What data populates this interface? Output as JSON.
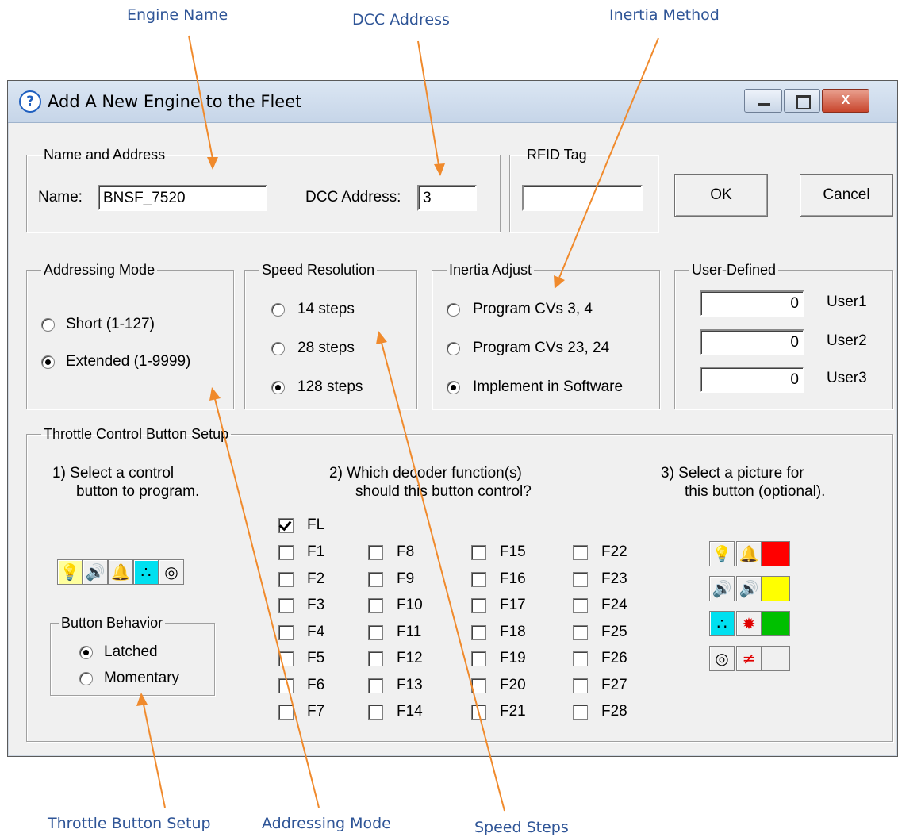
{
  "annotations": {
    "engine_name": "Engine Name",
    "dcc_address": "DCC Address",
    "inertia_method": "Inertia Method",
    "throttle_button_setup": "Throttle Button Setup",
    "addressing_mode": "Addressing Mode",
    "speed_steps": "Speed Steps",
    "arrow_color": "#f08a2c",
    "text_color": "#2f5597"
  },
  "window": {
    "title": "Add A New Engine to the Fleet",
    "title_icon": "?",
    "close_glyph": "X"
  },
  "name_address": {
    "legend": "Name and Address",
    "name_label": "Name:",
    "name_value": "BNSF_7520",
    "dcc_label": "DCC Address:",
    "dcc_value": "3"
  },
  "rfid": {
    "legend": "RFID Tag",
    "value": ""
  },
  "buttons": {
    "ok": "OK",
    "cancel": "Cancel"
  },
  "addressing_mode": {
    "legend": "Addressing Mode",
    "options": [
      "Short  (1-127)",
      "Extended  (1-9999)"
    ],
    "selected": "Extended  (1-9999)"
  },
  "speed_resolution": {
    "legend": "Speed Resolution",
    "options": [
      "14 steps",
      "28 steps",
      "128 steps"
    ],
    "selected": "128 steps"
  },
  "inertia_adjust": {
    "legend": "Inertia Adjust",
    "options": [
      "Program CVs 3, 4",
      "Program CVs 23, 24",
      "Implement in Software"
    ],
    "selected": "Implement in Software"
  },
  "user_defined": {
    "legend": "User-Defined",
    "fields": [
      {
        "label": "User1",
        "value": "0"
      },
      {
        "label": "User2",
        "value": "0"
      },
      {
        "label": "User3",
        "value": "0"
      }
    ]
  },
  "throttle_setup": {
    "legend": "Throttle Control Button Setup",
    "step1_line1": "1)  Select a control",
    "step1_line2": "button to program.",
    "step2_line1": "2)  Which decoder function(s)",
    "step2_line2": "should this button control?",
    "step3_line1": "3)  Select a picture for",
    "step3_line2": "this button (optional).",
    "control_buttons": [
      "light-bulb-icon",
      "horn-icon",
      "bell-icon",
      "steam-icon",
      "coupler-icon"
    ],
    "selected_control": "light-bulb-icon",
    "button_behavior": {
      "legend": "Button Behavior",
      "options": [
        "Latched",
        "Momentary"
      ],
      "selected": "Latched"
    },
    "functions": {
      "fl": {
        "label": "FL",
        "checked": true
      },
      "columns": [
        [
          "F1",
          "F2",
          "F3",
          "F4",
          "F5",
          "F6",
          "F7"
        ],
        [
          "F8",
          "F9",
          "F10",
          "F11",
          "F12",
          "F13",
          "F14"
        ],
        [
          "F15",
          "F16",
          "F17",
          "F18",
          "F19",
          "F20",
          "F21"
        ],
        [
          "F22",
          "F23",
          "F24",
          "F25",
          "F26",
          "F27",
          "F28"
        ]
      ],
      "checked": []
    },
    "pictures": [
      [
        "light-bulb-icon",
        "bell-icon",
        "red-swatch"
      ],
      [
        "horn-icon",
        "whistle-icon",
        "yellow-swatch"
      ],
      [
        "steam-icon",
        "flash-icon",
        "green-swatch"
      ],
      [
        "coupler-icon",
        "crossing-icon",
        "blank-swatch"
      ]
    ],
    "swatch_colors": {
      "red": "#ff0000",
      "yellow": "#ffff00",
      "green": "#00c000",
      "blank": "#f0f0f0"
    }
  }
}
